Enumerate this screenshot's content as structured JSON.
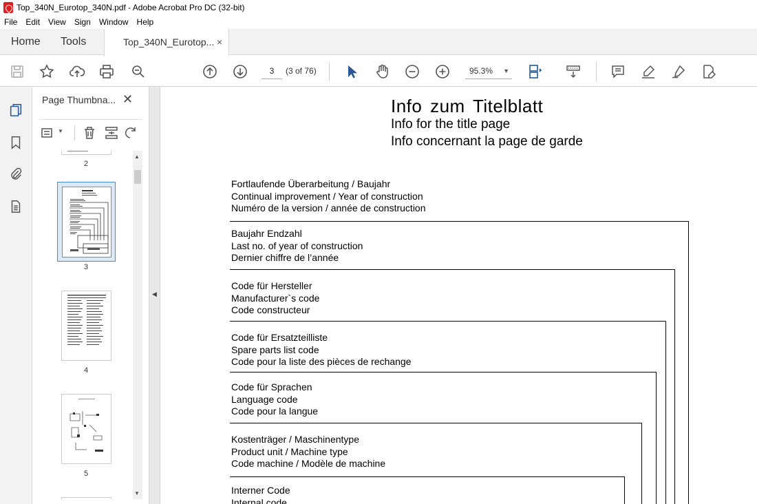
{
  "window": {
    "title": "Top_340N_Eurotop_340N.pdf - Adobe Acrobat Pro DC (32-bit)"
  },
  "menu": [
    "File",
    "Edit",
    "View",
    "Sign",
    "Window",
    "Help"
  ],
  "tabs": {
    "home": "Home",
    "tools": "Tools",
    "doc": "Top_340N_Eurotop...",
    "close": "×"
  },
  "toolbar": {
    "page_input": "3",
    "page_count": "(3 of 76)",
    "zoom": "95.3%"
  },
  "thumbnails": {
    "header": "Page Thumbna...",
    "close": "✕",
    "pages": [
      {
        "label": "2"
      },
      {
        "label": "3",
        "selected": true
      },
      {
        "label": "4"
      },
      {
        "label": "5"
      }
    ]
  },
  "document": {
    "title": "Info  zum  Titelblatt",
    "subtitle_en": "Info for the title page",
    "subtitle_fr": "Info concernant la page de garde",
    "fields": [
      {
        "de": "Fortlaufende Überarbeitung / Baujahr",
        "en": "Continual improvement / Year of construction",
        "fr": "Numéro de la version / année de construction"
      },
      {
        "de": "Baujahr Endzahl",
        "en": "Last no. of year of construction",
        "fr": "Dernier chiffre de l’année"
      },
      {
        "de": "Code für Hersteller",
        "en": "Manufacturer`s  code",
        "fr": "Code constructeur"
      },
      {
        "de": "Code für Ersatzteilliste",
        "en": "Spare parts list code",
        "fr": "Code pour la liste des pièces de rechange"
      },
      {
        "de": "Code für Sprachen",
        "en": "Language code",
        "fr": "Code pour la langue"
      },
      {
        "de": "Kostenträger / Maschinentype",
        "en": "Product unit / Machine type",
        "fr": "Code machine / Modèle de machine"
      },
      {
        "de": "Interner Code",
        "en": "Internal code",
        "fr": ""
      }
    ]
  },
  "colors": {
    "chrome_bg": "#f2f2f2",
    "accent_blue": "#2b5797",
    "selection": "#dbe8f5"
  }
}
